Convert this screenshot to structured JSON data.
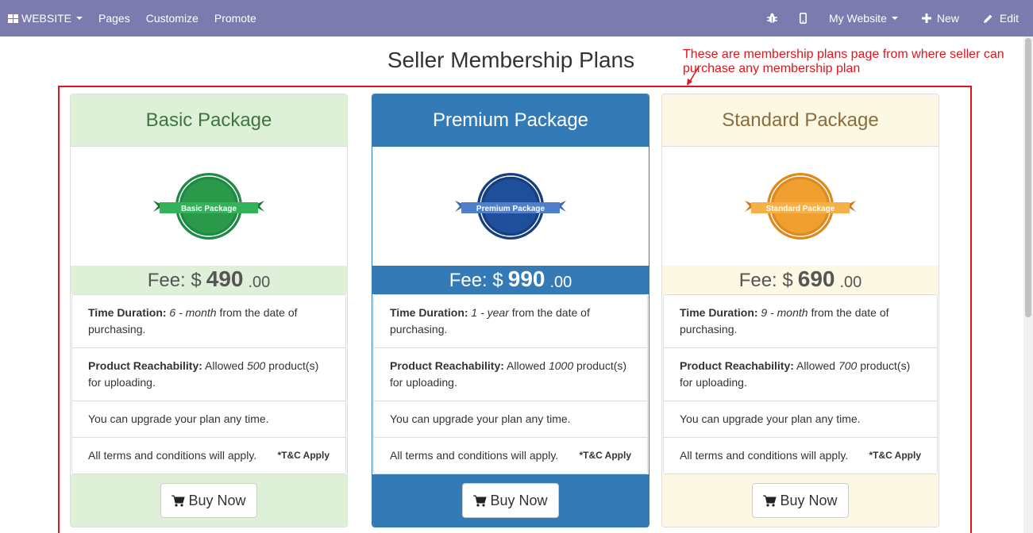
{
  "nav": {
    "website": "WEBSITE",
    "pages": "Pages",
    "customize": "Customize",
    "promote": "Promote",
    "my_website": "My Website",
    "new": "New",
    "edit": "Edit"
  },
  "page": {
    "title": "Seller Membership Plans",
    "annotation": "These are membership plans page from where seller can purchase any membership plan"
  },
  "plans": [
    {
      "name": "Basic Package",
      "badge_text": "Basic Package",
      "fee_label": "Fee:",
      "currency": "$",
      "amount": "490",
      "cents": ".00",
      "duration_label": "Time Duration:",
      "duration_value": "6 - month",
      "duration_suffix": "from the date of purchasing.",
      "reach_label": "Product Reachability:",
      "reach_prefix": "Allowed",
      "reach_value": "500",
      "reach_suffix": "product(s) for uploading.",
      "upgrade": "You can upgrade your plan any time.",
      "terms": "All terms and conditions will apply.",
      "tc": "*T&C Apply",
      "buy": "Buy Now",
      "color": "#2a9a4a"
    },
    {
      "name": "Premium Package",
      "badge_text": "Premium Package",
      "fee_label": "Fee:",
      "currency": "$",
      "amount": "990",
      "cents": ".00",
      "duration_label": "Time Duration:",
      "duration_value": "1 - year",
      "duration_suffix": "from the date of purchasing.",
      "reach_label": "Product Reachability:",
      "reach_prefix": "Allowed",
      "reach_value": "1000",
      "reach_suffix": "product(s) for uploading.",
      "upgrade": "You can upgrade your plan any time.",
      "terms": "All terms and conditions will apply.",
      "tc": "*T&C Apply",
      "buy": "Buy Now",
      "color": "#1f4e9a"
    },
    {
      "name": "Standard Package",
      "badge_text": "Standard Package",
      "fee_label": "Fee:",
      "currency": "$",
      "amount": "690",
      "cents": ".00",
      "duration_label": "Time Duration:",
      "duration_value": "9 - month",
      "duration_suffix": "from the date of purchasing.",
      "reach_label": "Product Reachability:",
      "reach_prefix": "Allowed",
      "reach_value": "700",
      "reach_suffix": "product(s) for uploading.",
      "upgrade": "You can upgrade your plan any time.",
      "terms": "All terms and conditions will apply.",
      "tc": "*T&C Apply",
      "buy": "Buy Now",
      "color": "#f0a030"
    }
  ]
}
